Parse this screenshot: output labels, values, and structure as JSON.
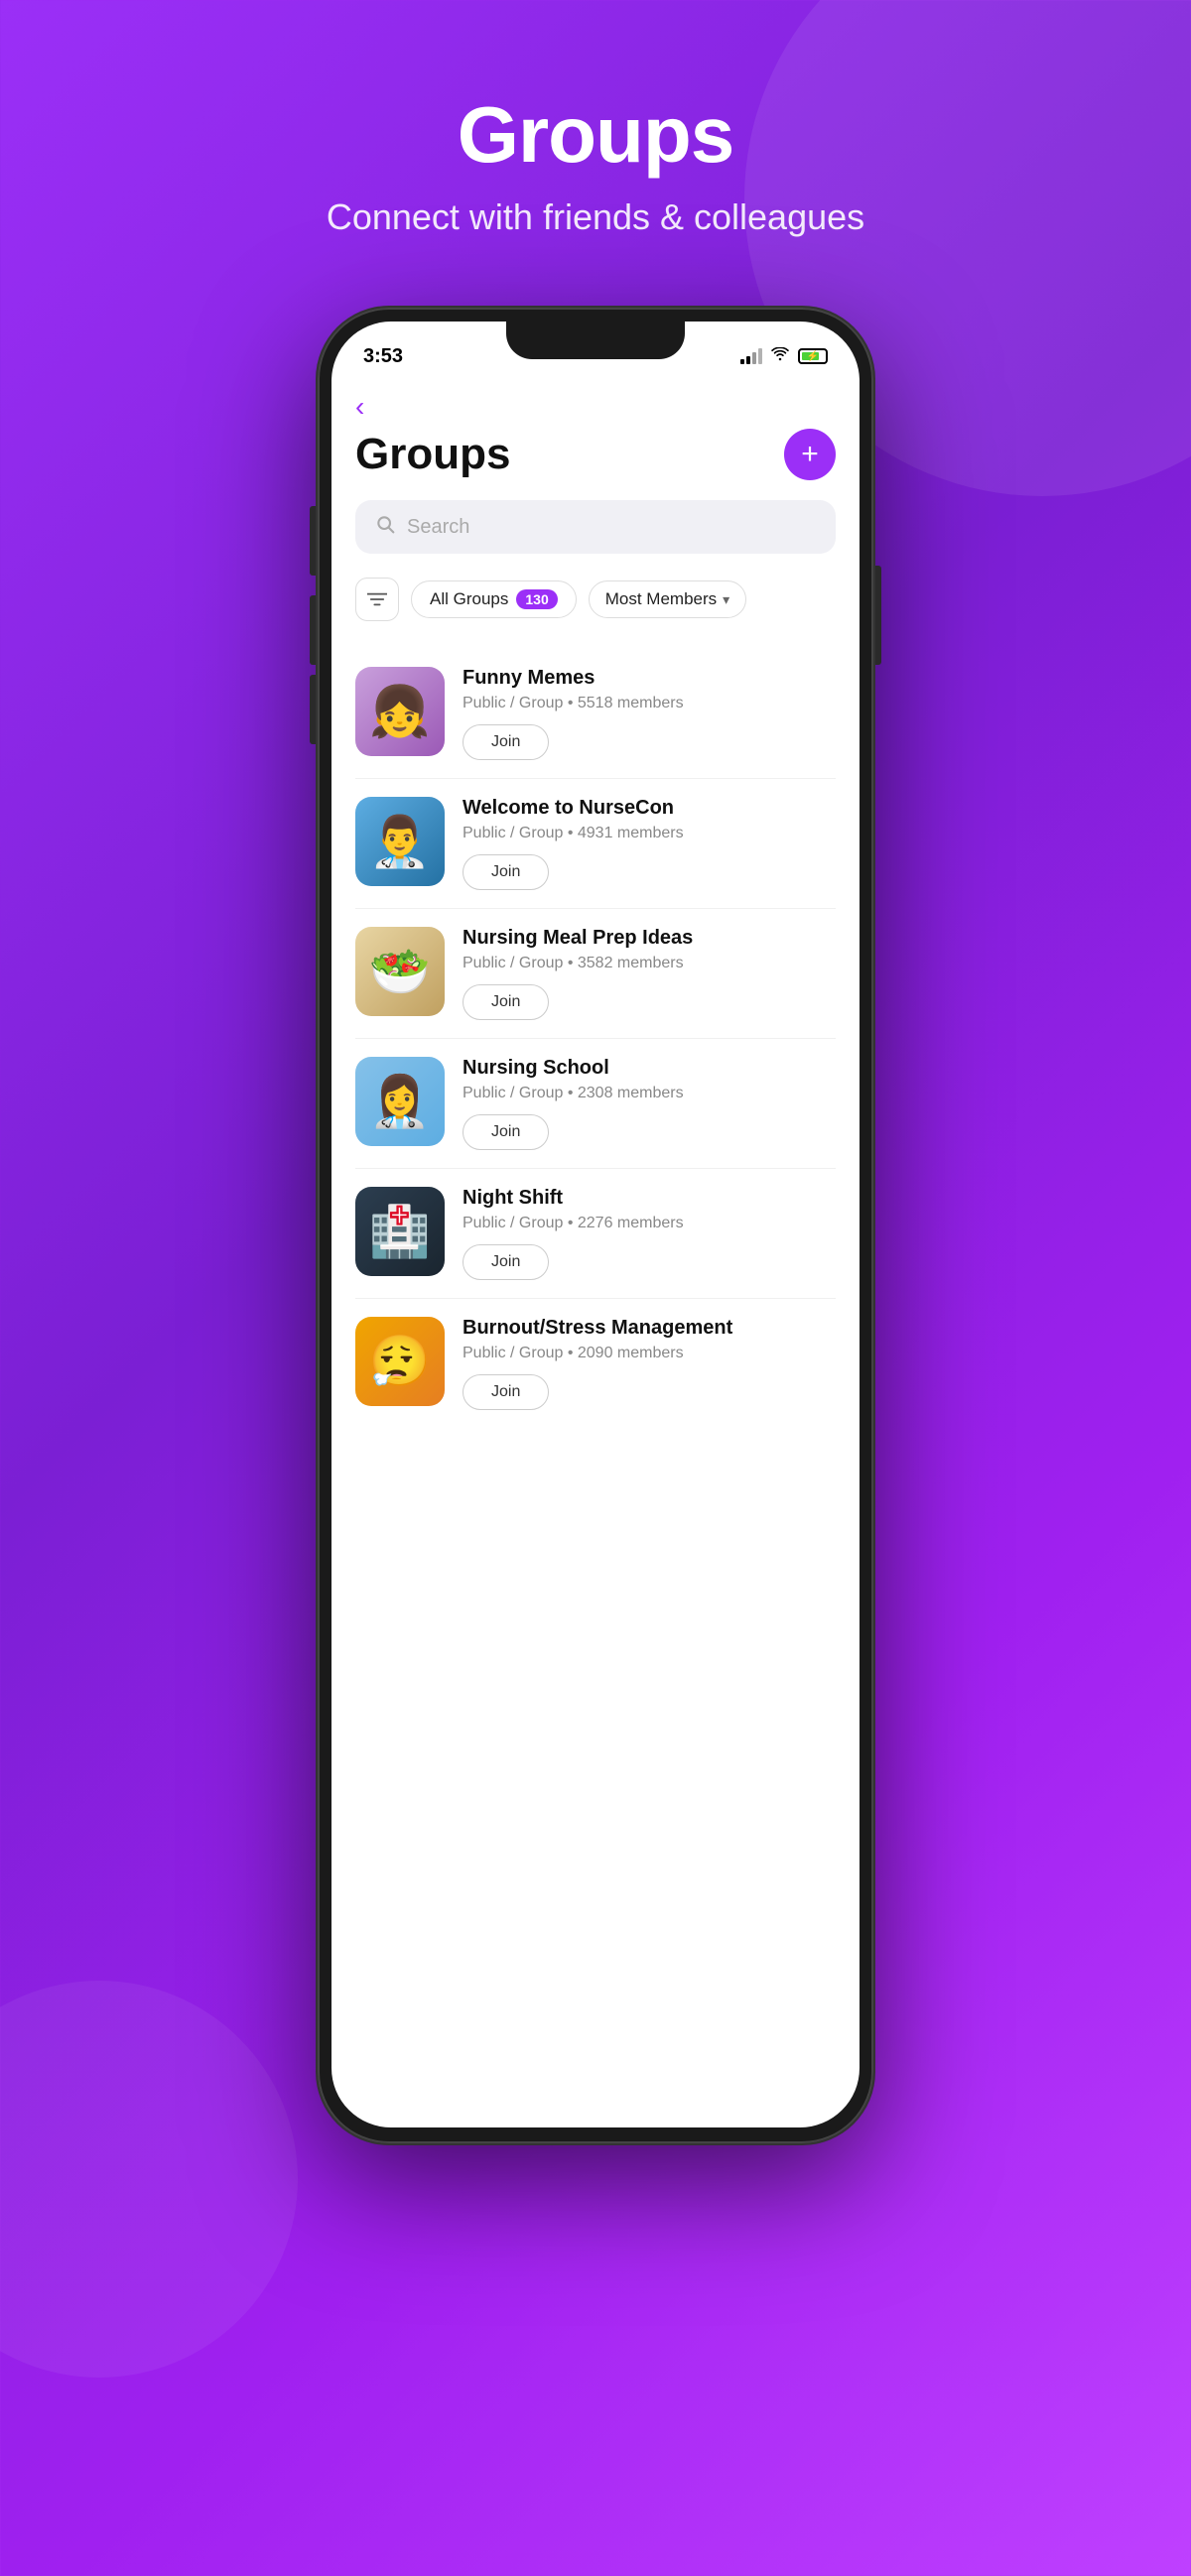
{
  "hero": {
    "title": "Groups",
    "subtitle": "Connect with friends & colleagues"
  },
  "status_bar": {
    "time": "3:53"
  },
  "app": {
    "page_title": "Groups",
    "add_button_label": "+",
    "search_placeholder": "Search",
    "filter": {
      "icon_label": "filter",
      "all_groups_label": "All Groups",
      "all_groups_count": "130",
      "sort_label": "Most Members"
    },
    "groups": [
      {
        "id": "funny-memes",
        "name": "Funny Memes",
        "meta": "Public / Group  •  5518 members",
        "join_label": "Join",
        "avatar_class": "avatar-funny-memes"
      },
      {
        "id": "welcome-nursecon",
        "name": "Welcome to NurseCon",
        "meta": "Public / Group  •  4931 members",
        "join_label": "Join",
        "avatar_class": "avatar-nursecon"
      },
      {
        "id": "nursing-meal-prep",
        "name": "Nursing Meal Prep Ideas",
        "meta": "Public / Group  •  3582 members",
        "join_label": "Join",
        "avatar_class": "avatar-meal-prep"
      },
      {
        "id": "nursing-school",
        "name": "Nursing School",
        "meta": "Public / Group  •  2308 members",
        "join_label": "Join",
        "avatar_class": "avatar-nursing-school"
      },
      {
        "id": "night-shift",
        "name": "Night Shift",
        "meta": "Public / Group  •  2276 members",
        "join_label": "Join",
        "avatar_class": "avatar-night-shift"
      },
      {
        "id": "burnout-stress",
        "name": "Burnout/Stress Management",
        "meta": "Public / Group  •  2090 members",
        "join_label": "Join",
        "avatar_class": "avatar-burnout"
      }
    ]
  }
}
